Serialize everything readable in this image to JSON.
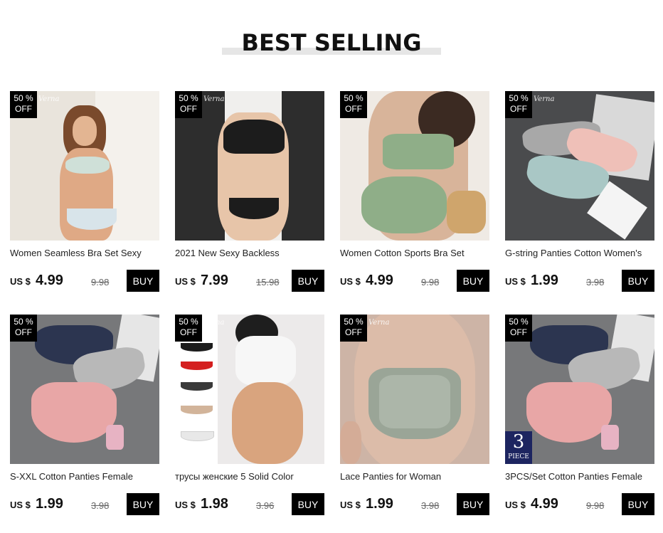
{
  "section": {
    "title": "BEST SELLING"
  },
  "products": [
    {
      "title": "Women Seamless Bra Set Sexy",
      "currency": "US $",
      "price": "4.99",
      "old_price": "9.98",
      "badge": [
        "50 %",
        "OFF"
      ],
      "brand_mark": "Verna",
      "buy_label": "BUY",
      "image": "woman-floral-bikini-photo"
    },
    {
      "title": "2021 New Sexy Backless",
      "currency": "US $",
      "price": "7.99",
      "old_price": "15.98",
      "badge": [
        "50 %",
        "OFF"
      ],
      "brand_mark": "Verna",
      "buy_label": "BUY",
      "image": "black-lace-lingerie-photo"
    },
    {
      "title": "Women Cotton Sports Bra Set",
      "currency": "US $",
      "price": "4.99",
      "old_price": "9.98",
      "badge": [
        "50 %",
        "OFF"
      ],
      "brand_mark": "",
      "buy_label": "BUY",
      "image": "green-sports-bra-set-photo"
    },
    {
      "title": "G-string Panties Cotton Women's",
      "currency": "US $",
      "price": "1.99",
      "old_price": "3.98",
      "badge": [
        "50 %",
        "OFF"
      ],
      "brand_mark": "Verna",
      "buy_label": "BUY",
      "image": "gstring-panties-flatlay-photo"
    },
    {
      "title": "S-XXL Cotton Panties Female",
      "currency": "US $",
      "price": "1.99",
      "old_price": "3.98",
      "badge": [
        "50 %",
        "OFF"
      ],
      "brand_mark": "",
      "buy_label": "BUY",
      "image": "cotton-panties-flatlay-photo"
    },
    {
      "title": "трусы женские 5 Solid Color",
      "currency": "US $",
      "price": "1.98",
      "old_price": "3.96",
      "badge": [
        "50 %",
        "OFF"
      ],
      "brand_mark": "Verna",
      "buy_label": "BUY",
      "image": "thong-colors-photo"
    },
    {
      "title": "Lace Panties for Woman",
      "currency": "US $",
      "price": "1.99",
      "old_price": "3.98",
      "badge": [
        "50 %",
        "OFF"
      ],
      "brand_mark": "Verna",
      "buy_label": "BUY",
      "image": "lace-panties-photo"
    },
    {
      "title": "3PCS/Set Cotton Panties Female",
      "currency": "US $",
      "price": "4.99",
      "old_price": "9.98",
      "badge": [
        "50 %",
        "OFF"
      ],
      "brand_mark": "",
      "buy_label": "BUY",
      "image": "cotton-panties-3pack-photo",
      "piece": {
        "num": "3",
        "label": "PIECE"
      }
    }
  ],
  "colors": {
    "accent": "#000000",
    "heading_bar": "#e6e6e6",
    "piece_badge": "#1d2560"
  }
}
